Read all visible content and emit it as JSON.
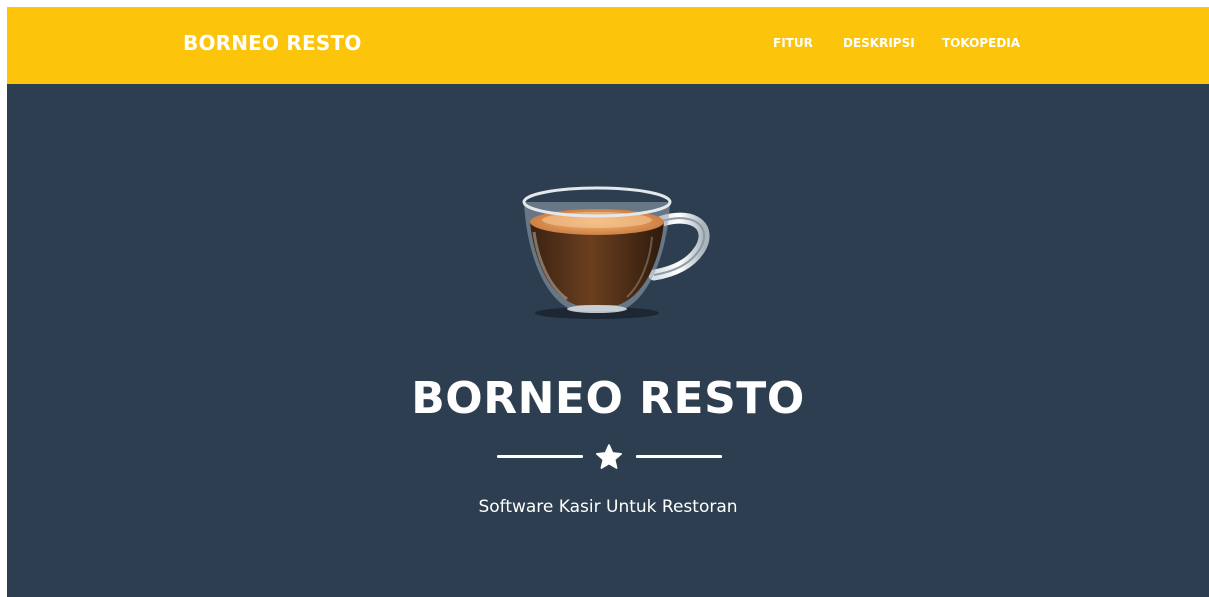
{
  "navbar": {
    "brand": "BORNEO RESTO",
    "links": [
      {
        "label": "FITUR"
      },
      {
        "label": "DESKRIPSI"
      },
      {
        "label": "TOKOPEDIA"
      }
    ],
    "background_color": "#fcc40a"
  },
  "hero": {
    "image_icon": "coffee-cup-icon",
    "title": "BORNEO RESTO",
    "divider_icon": "star-icon",
    "subtitle": "Software Kasir Untuk Restoran",
    "background_color": "#2c3e50"
  }
}
